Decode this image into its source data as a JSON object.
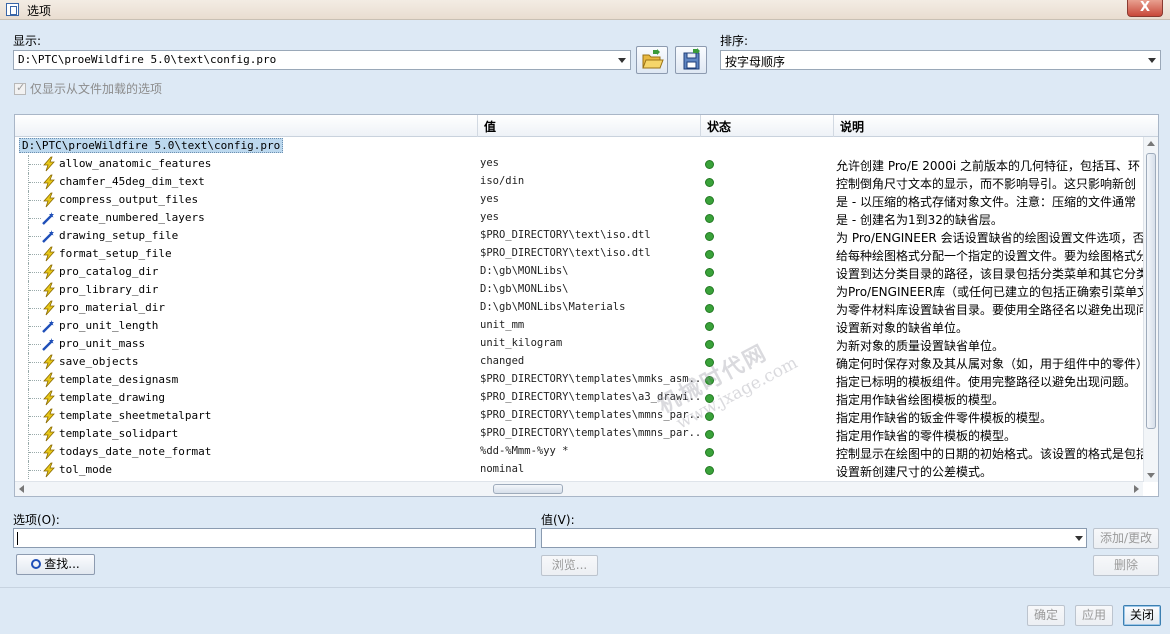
{
  "window": {
    "title": "选项",
    "close_label": "X"
  },
  "show": {
    "label": "显示:",
    "file_path": "D:\\PTC\\proeWildfire 5.0\\text\\config.pro",
    "open_icon": "folder-open-icon",
    "save_icon": "save-config-icon"
  },
  "sort": {
    "label": "排序:",
    "value": "按字母顺序"
  },
  "only_loaded": {
    "label": "仅显示从文件加载的选项",
    "checked": true,
    "enabled": false
  },
  "table": {
    "columns": [
      "",
      "值",
      "状态",
      "说明"
    ],
    "root": "D:\\PTC\\proeWildfire 5.0\\text\\config.pro",
    "rows": [
      {
        "name": "allow_anatomic_features",
        "value": "yes",
        "status": "green",
        "icon": "lightning-icon",
        "desc": "允许创建 Pro/E 2000i 之前版本的几何特征，包括耳、环"
      },
      {
        "name": "chamfer_45deg_dim_text",
        "value": "iso/din",
        "status": "green",
        "icon": "lightning-icon",
        "desc": "控制倒角尺寸文本的显示，而不影响导引。这只影响新创"
      },
      {
        "name": "compress_output_files",
        "value": "yes",
        "status": "green",
        "icon": "lightning-icon",
        "desc": "是 - 以压缩的格式存储对象文件。注意：压缩的文件通常"
      },
      {
        "name": "create_numbered_layers",
        "value": "yes",
        "status": "green",
        "icon": "wand-icon",
        "desc": "是 - 创建名为1到32的缺省层。"
      },
      {
        "name": "drawing_setup_file",
        "value": "$PRO_DIRECTORY\\text\\iso.dtl",
        "status": "green",
        "icon": "wand-icon",
        "desc": "为 Pro/ENGINEER 会话设置缺省的绘图设置文件选项，否则"
      },
      {
        "name": "format_setup_file",
        "value": "$PRO_DIRECTORY\\text\\iso.dtl",
        "status": "green",
        "icon": "lightning-icon",
        "desc": "给每种绘图格式分配一个指定的设置文件。要为绘图格式分"
      },
      {
        "name": "pro_catalog_dir",
        "value": "D:\\gb\\MONLibs\\",
        "status": "green",
        "icon": "lightning-icon",
        "desc": "设置到达分类目录的路径，该目录包括分类菜单和其它分类"
      },
      {
        "name": "pro_library_dir",
        "value": "D:\\gb\\MONLibs\\",
        "status": "green",
        "icon": "lightning-icon",
        "desc": "为Pro/ENGINEER库（或任何已建立的包括正确索引菜单文件"
      },
      {
        "name": "pro_material_dir",
        "value": "D:\\gb\\MONLibs\\Materials",
        "status": "green",
        "icon": "lightning-icon",
        "desc": "为零件材料库设置缺省目录。要使用全路径名以避免出现问"
      },
      {
        "name": "pro_unit_length",
        "value": "unit_mm",
        "status": "green",
        "icon": "wand-icon",
        "desc": "设置新对象的缺省单位。"
      },
      {
        "name": "pro_unit_mass",
        "value": "unit_kilogram",
        "status": "green",
        "icon": "wand-icon",
        "desc": "为新对象的质量设置缺省单位。"
      },
      {
        "name": "save_objects",
        "value": "changed",
        "status": "green",
        "icon": "lightning-icon",
        "desc": "确定何时保存对象及其从属对象（如，用于组件中的零件）"
      },
      {
        "name": "template_designasm",
        "value": "$PRO_DIRECTORY\\templates\\mmks_asm...",
        "status": "green",
        "icon": "lightning-icon",
        "desc": "指定已标明的模板组件。使用完整路径以避免出现问题。"
      },
      {
        "name": "template_drawing",
        "value": "$PRO_DIRECTORY\\templates\\a3_drawi...",
        "status": "green",
        "icon": "lightning-icon",
        "desc": "指定用作缺省绘图模板的模型。"
      },
      {
        "name": "template_sheetmetalpart",
        "value": "$PRO_DIRECTORY\\templates\\mmns_par...",
        "status": "green",
        "icon": "lightning-icon",
        "desc": "指定用作缺省的钣金件零件模板的模型。"
      },
      {
        "name": "template_solidpart",
        "value": "$PRO_DIRECTORY\\templates\\mmns_par...",
        "status": "green",
        "icon": "lightning-icon",
        "desc": "指定用作缺省的零件模板的模型。"
      },
      {
        "name": "todays_date_note_format",
        "value": "%dd-%Mmm-%yy *",
        "status": "green",
        "icon": "lightning-icon",
        "desc": "控制显示在绘图中的日期的初始格式。该设置的格式是包括"
      },
      {
        "name": "tol_mode",
        "value": "nominal",
        "status": "green",
        "icon": "lightning-icon",
        "desc": "设置新创建尺寸的公差模式。"
      }
    ]
  },
  "watermark": {
    "line1": "机械时代网",
    "line2": "www.jxage.com"
  },
  "option": {
    "label": "选项(O):",
    "value": ""
  },
  "value_field": {
    "label": "值(V):",
    "value": ""
  },
  "buttons": {
    "add_change": "添加/更改",
    "find": "查找...",
    "browse": "浏览...",
    "delete": "删除",
    "ok": "确定",
    "apply": "应用",
    "close": "关闭"
  },
  "colors": {
    "status_green": "#3aa23a",
    "lightning": "#e8c81a",
    "wand": "#1f4fb8",
    "root_highlight": "#bcd8ee"
  }
}
